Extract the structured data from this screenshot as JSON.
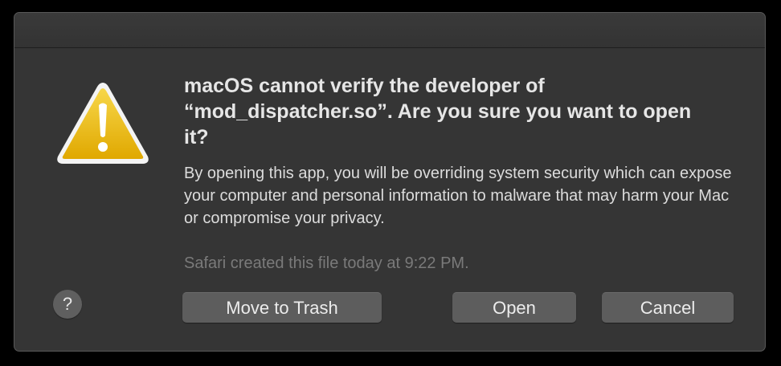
{
  "dialog": {
    "title": "macOS cannot verify the developer of “mod_dispatcher.so”. Are you sure you want to open it?",
    "message": "By opening this app, you will be overriding system security which can expose your computer and personal information to malware that may harm your Mac or compromise your privacy.",
    "info": "Safari created this file today at 9:22 PM.",
    "icon": "warning-icon",
    "help_label": "?",
    "buttons": {
      "move_to_trash": "Move to Trash",
      "open": "Open",
      "cancel": "Cancel"
    }
  },
  "colors": {
    "background": "#353535",
    "warning_yellow": "#f2c31a",
    "button": "#5d5d5d"
  }
}
